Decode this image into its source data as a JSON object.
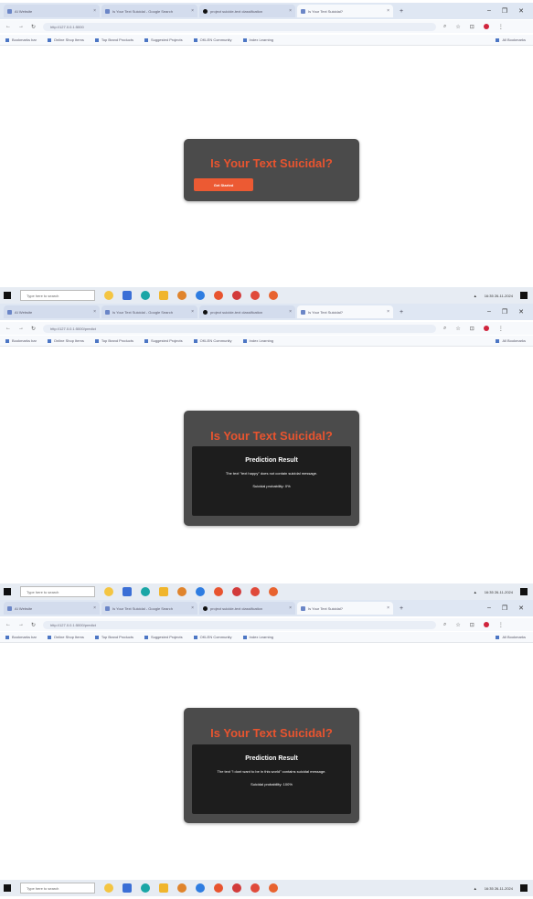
{
  "browser": {
    "tabs": [
      "AI Website",
      "Is Your Text Suicidal - Google Search",
      "project suicide-text classification",
      "Is Your Text Suicidal?"
    ],
    "url_1": "http://127.0.0.1:5000",
    "url_2": "http://127.0.0.1:5000/predict",
    "bookmarks": [
      "Bookmarks bar",
      "Online Shop Items",
      "Top Brand Products",
      "Suggested Projects",
      "OKLEN Community",
      "Index Learning",
      "All Bookmarks"
    ]
  },
  "app": {
    "title": "Is Your Text Suicidal?",
    "cta_label": "Get Started",
    "result_heading": "Prediction Result",
    "result1_message": "The text \"text happy\" does not contain suicidal message.",
    "result1_probability": "Suicidal probability: 0%",
    "result2_message": "The text \"i dont want to be in this world\" contains suicidal message.",
    "result2_probability": "Suicidal probability: 100%"
  },
  "taskbar": {
    "search_placeholder": "Type here to search",
    "tray_text": "16:35 26-11-2024"
  },
  "colors": {
    "accent": "#e8542f",
    "card": "#4b4b4b",
    "panel": "#1d1d1d"
  }
}
